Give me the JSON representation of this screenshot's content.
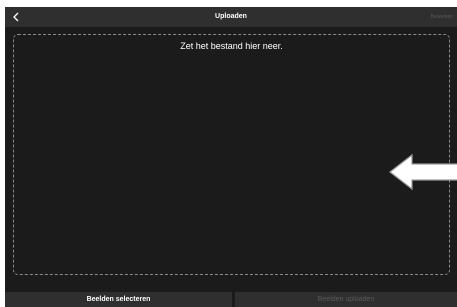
{
  "header": {
    "title": "Uploaden",
    "back_icon": "chevron-left-icon",
    "edit_label": "Bewerken"
  },
  "dropzone": {
    "text": "Zet het bestand hier neer."
  },
  "arrow_icon": "arrow-left-icon",
  "footer": {
    "select_label": "Beelden selecteren",
    "upload_label": "Beelden uploaden"
  },
  "colors": {
    "background": "#1b1b1b",
    "bar": "#2f2f2f",
    "disabled_text": "#5a5a5a",
    "text": "#ffffff"
  }
}
